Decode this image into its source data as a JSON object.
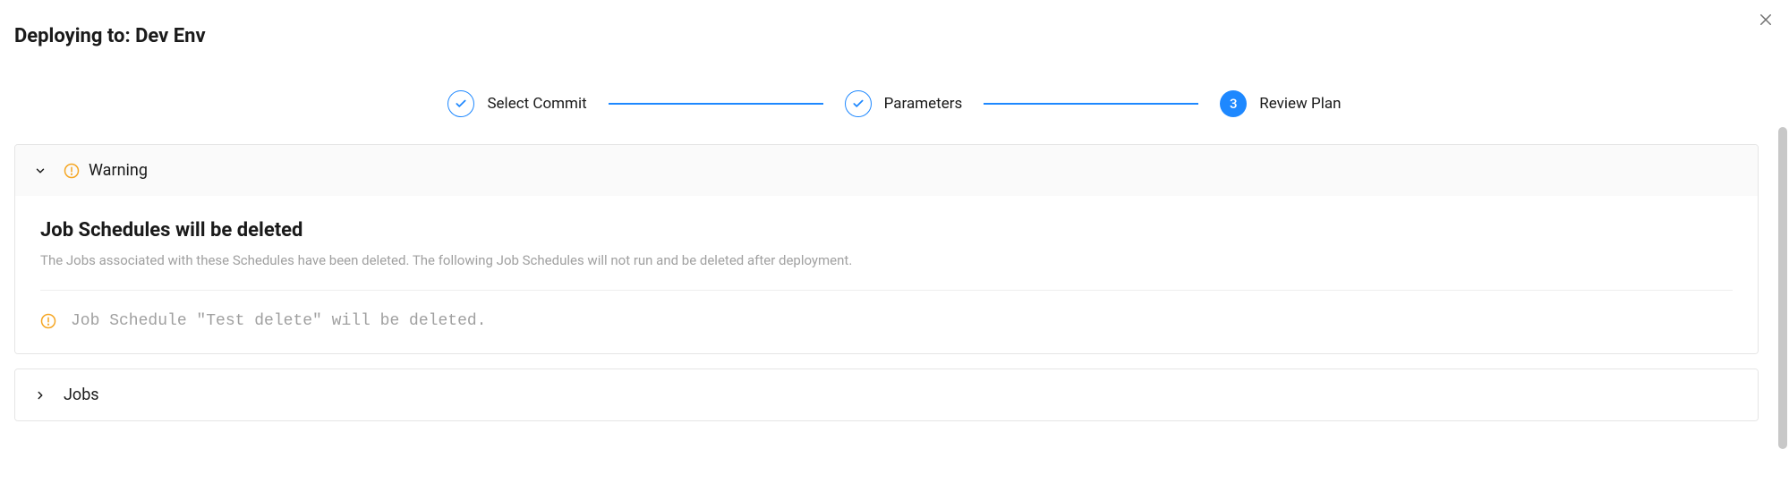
{
  "header": {
    "title": "Deploying to: Dev Env"
  },
  "stepper": {
    "steps": [
      {
        "label": "Select Commit",
        "state": "done"
      },
      {
        "label": "Parameters",
        "state": "done"
      },
      {
        "label": "Review Plan",
        "state": "active",
        "number": "3"
      }
    ]
  },
  "warning_panel": {
    "header_label": "Warning",
    "title": "Job Schedules will be deleted",
    "description": "The Jobs associated with these Schedules have been deleted. The following Job Schedules will not run and be deleted after deployment.",
    "items": [
      "Job Schedule \"Test delete\" will be deleted."
    ]
  },
  "jobs_panel": {
    "header_label": "Jobs"
  }
}
